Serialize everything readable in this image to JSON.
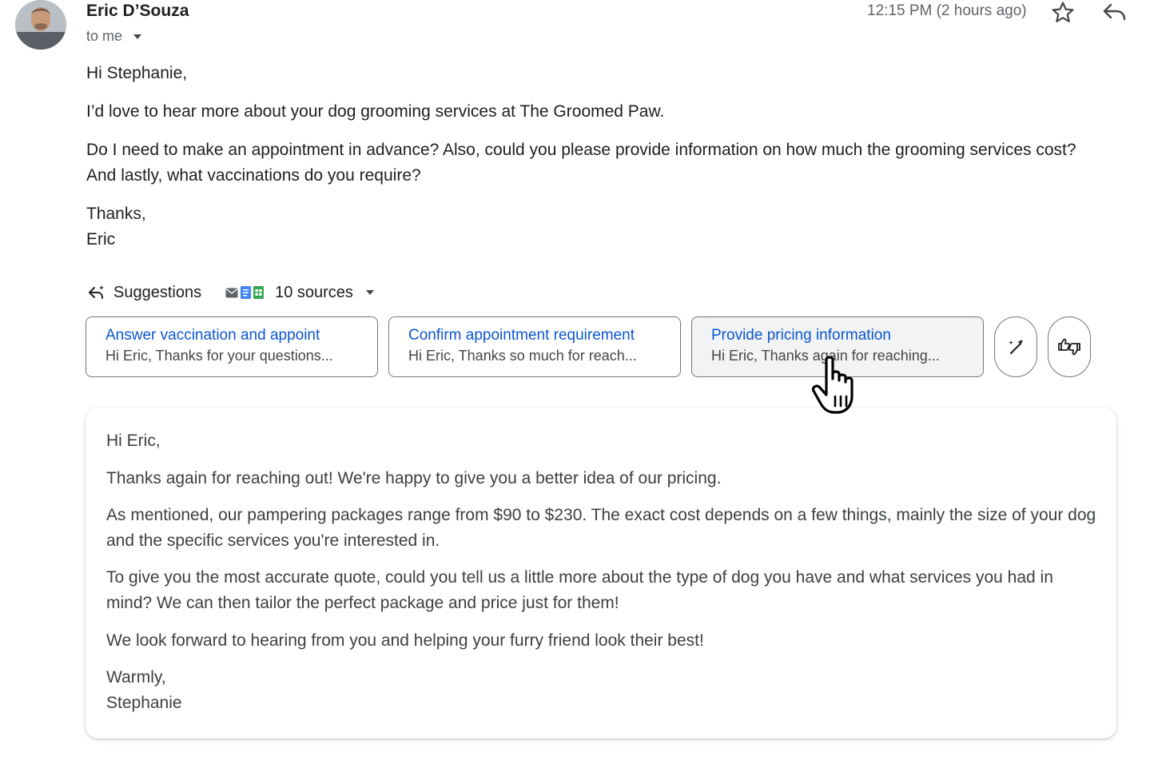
{
  "message": {
    "sender_name": "Eric D’Souza",
    "recipient_label": "to me",
    "timestamp": "12:15 PM (2 hours ago)",
    "avatar_icon": "avatar-photo",
    "body": {
      "greeting": "Hi Stephanie,",
      "paragraph_1": "I’d love to hear more about your dog grooming services at The Groomed Paw.",
      "paragraph_2": "Do I need to make an appointment in advance? Also, could you please provide information on how much the grooming services cost? And lastly, what vaccinations do you require?",
      "signoff": "Thanks,",
      "signature": "Eric"
    }
  },
  "suggestions": {
    "label": "Suggestions",
    "sources_label": "10 sources",
    "source_icons": [
      "gmail-icon",
      "docs-icon",
      "sheets-icon"
    ],
    "cards": [
      {
        "title": "Answer vaccination and appoint",
        "preview": "Hi Eric, Thanks for your questions..."
      },
      {
        "title": "Confirm appointment requirement",
        "preview": "Hi Eric, Thanks so much for reach..."
      },
      {
        "title": "Provide pricing information",
        "preview": "Hi Eric, Thanks again for reaching..."
      }
    ],
    "selected_index": 2
  },
  "draft": {
    "greeting": "Hi Eric,",
    "paragraph_1": "Thanks again for reaching out! We're happy to give you a better idea of our pricing.",
    "paragraph_2": "As mentioned, our pampering packages range from $90 to $230. The exact cost depends on a few things, mainly the size of your dog and the specific services you're interested in.",
    "paragraph_3": "To give you the most accurate quote, could you tell us a little more about the type of dog you have and what services you had in mind? We can then tailor the perfect package and price just for them!",
    "paragraph_4": "We look forward to hearing from you and helping your furry friend look their best!",
    "signoff": "Warmly,",
    "signature": "Stephanie"
  },
  "colors": {
    "link_blue": "#0b57d0",
    "text_primary": "#1f1f1f",
    "text_secondary": "#5f6368",
    "border": "#747775"
  }
}
